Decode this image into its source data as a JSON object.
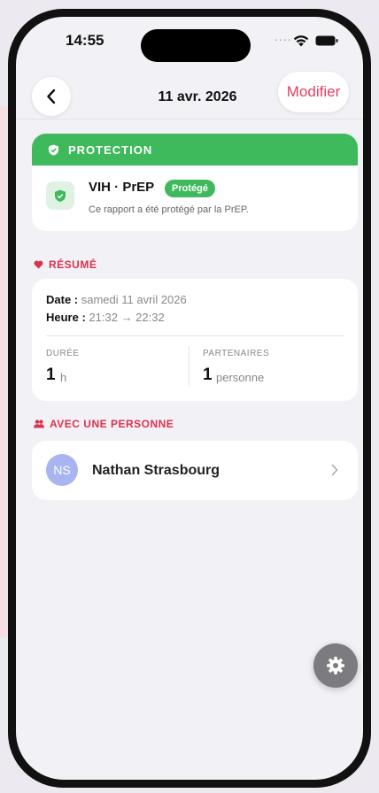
{
  "status_bar": {
    "time": "14:55",
    "signal_dots": "....",
    "wifi_icon": "wifi-icon",
    "battery_icon": "battery-icon"
  },
  "nav": {
    "back_icon": "chevron-left-icon",
    "title": "11 avr. 2026",
    "edit_label": "Modifier"
  },
  "protection": {
    "header": "PROTECTION",
    "title": "VIH · PrEP",
    "badge": "Protégé",
    "description": "Ce rapport a été protégé par la PrEP."
  },
  "summary": {
    "section_title": "RÉSUMÉ",
    "date_label": "Date :",
    "date_value": "samedi 11 avril 2026",
    "time_label": "Heure :",
    "time_value": "21:32 → 22:32",
    "duration_label": "DURÉE",
    "duration_value": "1",
    "duration_unit": "h",
    "partners_label": "PARTENAIRES",
    "partners_value": "1",
    "partners_unit": "personne"
  },
  "person_section": {
    "title": "AVEC UNE PERSONNE",
    "person": {
      "initials": "NS",
      "name": "Nathan Strasbourg"
    }
  },
  "colors": {
    "accent": "#e33e62",
    "protection_green": "#3eb95b",
    "avatar": "#a8b5f0",
    "section_red": "#d9324f"
  },
  "fab": {
    "icon": "gear-icon"
  }
}
